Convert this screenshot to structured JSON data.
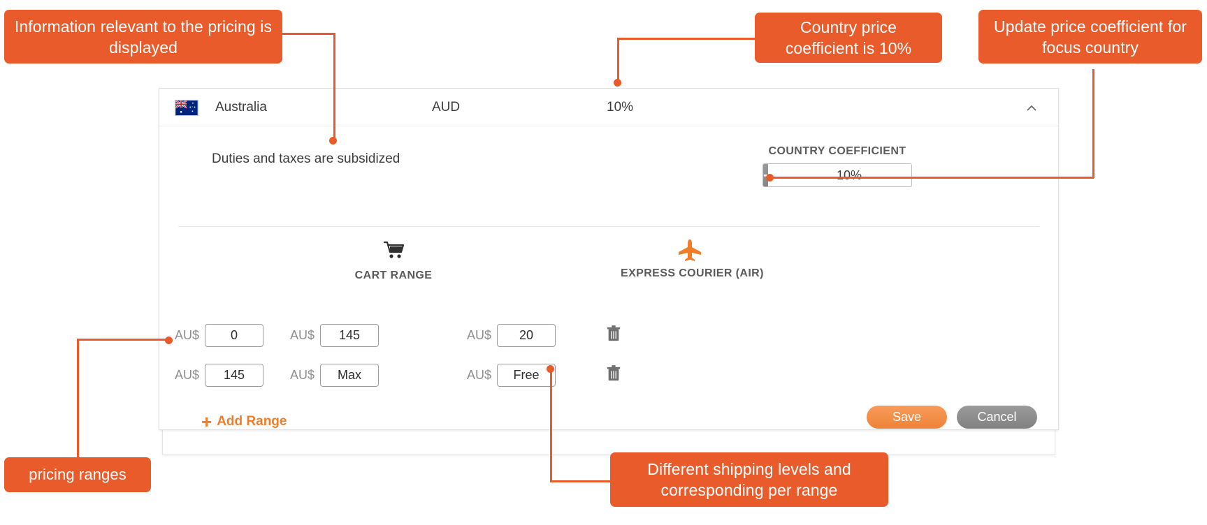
{
  "panel": {
    "header": {
      "flag_icon": "australia-flag-icon",
      "country": "Australia",
      "currency": "AUD",
      "coefficient_percent": "10%",
      "collapse_icon": "chevron-up-icon"
    },
    "subsidy_note": "Duties and taxes are subsidized",
    "coefficient": {
      "label": "COUNTRY COEFFICIENT",
      "decrement_label": "-",
      "value": "10%",
      "increment_label": "+"
    },
    "columns": [
      {
        "icon": "shopping-cart-icon",
        "glyph": "🛒",
        "label": "CART RANGE"
      },
      {
        "icon": "airplane-icon",
        "glyph": "✈",
        "label": "EXPRESS COURIER (AIR)"
      }
    ],
    "currency_prefix": "AU$",
    "rows": [
      {
        "from": "0",
        "to": "145",
        "air": "20",
        "delete_icon": "trash-icon",
        "delete_glyph": "🗑"
      },
      {
        "from": "145",
        "to": "Max",
        "air": "Free",
        "delete_icon": "trash-icon",
        "delete_glyph": "🗑"
      }
    ],
    "add_range_label": "Add Range",
    "add_range_plus": "+",
    "save_label": "Save",
    "cancel_label": "Cancel"
  },
  "annotations": [
    {
      "id": "info-pricing",
      "text": "Information relevant to the pricing is displayed"
    },
    {
      "id": "country-price",
      "text": "Country price coefficient is 10%"
    },
    {
      "id": "update-coefficient",
      "text": "Update price coefficient for focus country"
    },
    {
      "id": "pricing-ranges",
      "text": "pricing ranges"
    },
    {
      "id": "shipping-levels",
      "text": "Different shipping levels and corresponding per range"
    }
  ],
  "colors": {
    "accent_orange": "#ea5b2b",
    "button_orange": "#ef8237",
    "gray": "#858585"
  }
}
